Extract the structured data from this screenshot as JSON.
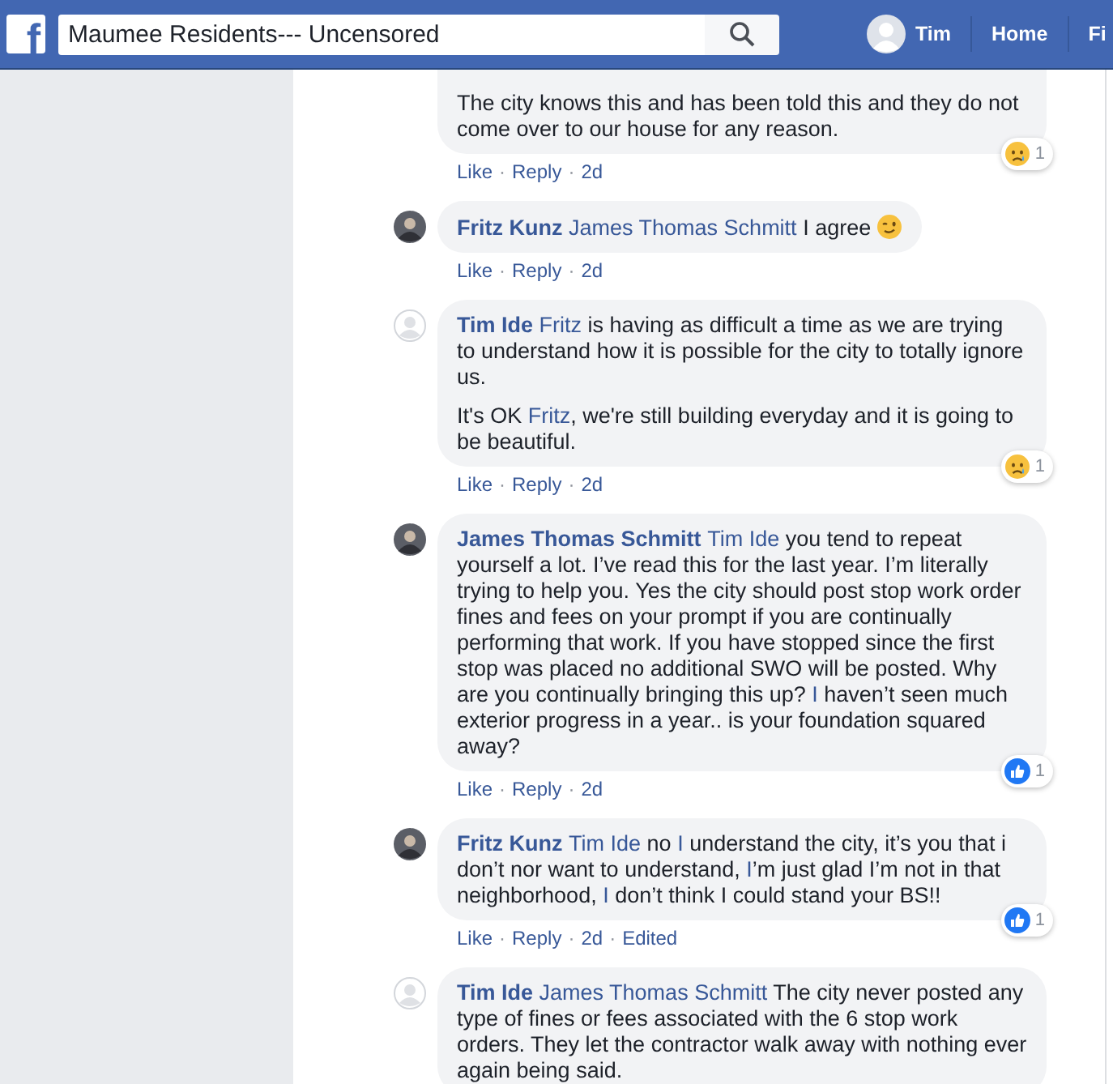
{
  "header": {
    "logo": "f",
    "search": {
      "value": "Maumee Residents--- Uncensored"
    },
    "nav": [
      {
        "label": "Tim",
        "kind": "profile"
      },
      {
        "label": "Home",
        "kind": "link"
      },
      {
        "label": "Fi",
        "kind": "link"
      }
    ]
  },
  "comments": [
    {
      "paragraphs": [
        [
          {
            "text": "The city knows this and has been told this and they do not come over to our house for any reason.",
            "kind": "plain"
          }
        ]
      ],
      "meta": [
        {
          "text": "Like",
          "kind": "link"
        },
        {
          "text": "·",
          "kind": "sep"
        },
        {
          "text": "Reply",
          "kind": "link"
        },
        {
          "text": "·",
          "kind": "sep"
        },
        {
          "text": "2d",
          "kind": "link"
        }
      ],
      "reaction": {
        "kind": "sad",
        "count": "1"
      }
    },
    {
      "avatar": {
        "kind": "photo"
      },
      "author": "Fritz Kunz",
      "paragraphs": [
        [
          {
            "text": "James Thomas Schmitt",
            "kind": "mention"
          },
          {
            "text": " I agree ",
            "kind": "plain"
          },
          {
            "kind": "emoji"
          }
        ]
      ],
      "meta": [
        {
          "text": "Like",
          "kind": "link"
        },
        {
          "text": "·",
          "kind": "sep"
        },
        {
          "text": "Reply",
          "kind": "link"
        },
        {
          "text": "·",
          "kind": "sep"
        },
        {
          "text": "2d",
          "kind": "link"
        }
      ]
    },
    {
      "avatar": {
        "kind": "default"
      },
      "author": "Tim Ide",
      "paragraphs": [
        [
          {
            "text": "Fritz",
            "kind": "mention"
          },
          {
            "text": " is having as difficult a time as we are trying to understand how it is possible for the city to totally ignore us.",
            "kind": "plain"
          }
        ],
        [
          {
            "text": "It's OK ",
            "kind": "plain"
          },
          {
            "text": "Fritz",
            "kind": "mention"
          },
          {
            "text": ", we're still building everyday and it is going to be beautiful.",
            "kind": "plain"
          }
        ]
      ],
      "meta": [
        {
          "text": "Like",
          "kind": "link"
        },
        {
          "text": "·",
          "kind": "sep"
        },
        {
          "text": "Reply",
          "kind": "link"
        },
        {
          "text": "·",
          "kind": "sep"
        },
        {
          "text": "2d",
          "kind": "link"
        }
      ],
      "reaction": {
        "kind": "sad",
        "count": "1"
      }
    },
    {
      "avatar": {
        "kind": "photo"
      },
      "author": "James Thomas Schmitt",
      "paragraphs": [
        [
          {
            "text": "Tim Ide",
            "kind": "mention"
          },
          {
            "text": " you tend to repeat yourself a lot. I’ve read this for the last year. I’m literally trying to help you. Yes the city should post stop work order fines and fees on your prompt if you are continually performing that work. If you have stopped since the first stop was placed no additional SWO will be posted. Why are you continually bringing this up? ",
            "kind": "plain"
          },
          {
            "text": "I",
            "kind": "mention"
          },
          {
            "text": " haven’t seen much exterior progress in a year.. is your foundation squared away?",
            "kind": "plain"
          }
        ]
      ],
      "meta": [
        {
          "text": "Like",
          "kind": "link"
        },
        {
          "text": "·",
          "kind": "sep"
        },
        {
          "text": "Reply",
          "kind": "link"
        },
        {
          "text": "·",
          "kind": "sep"
        },
        {
          "text": "2d",
          "kind": "link"
        }
      ],
      "reaction": {
        "kind": "like",
        "count": "1"
      }
    },
    {
      "avatar": {
        "kind": "photo"
      },
      "author": "Fritz Kunz",
      "paragraphs": [
        [
          {
            "text": "Tim Ide",
            "kind": "mention"
          },
          {
            "text": " no ",
            "kind": "plain"
          },
          {
            "text": "I",
            "kind": "mention"
          },
          {
            "text": " understand the city, it’s you that i don’t nor want to understand, ",
            "kind": "plain"
          },
          {
            "text": "I",
            "kind": "mention"
          },
          {
            "text": "’m just glad I’m not in that neighborhood, ",
            "kind": "plain"
          },
          {
            "text": "I",
            "kind": "mention"
          },
          {
            "text": " don’t think I could stand your BS!!",
            "kind": "plain"
          }
        ]
      ],
      "meta": [
        {
          "text": "Like",
          "kind": "link"
        },
        {
          "text": "·",
          "kind": "sep"
        },
        {
          "text": "Reply",
          "kind": "link"
        },
        {
          "text": "·",
          "kind": "sep"
        },
        {
          "text": "2d",
          "kind": "link"
        },
        {
          "text": "·",
          "kind": "sep"
        },
        {
          "text": "Edited",
          "kind": "link"
        }
      ],
      "reaction": {
        "kind": "like",
        "count": "1"
      }
    },
    {
      "avatar": {
        "kind": "default"
      },
      "author": "Tim Ide",
      "paragraphs": [
        [
          {
            "text": "James Thomas Schmitt",
            "kind": "mention"
          },
          {
            "text": " The city never posted any type of fines or fees associated with the 6 stop work orders. They let the contractor walk away with nothing ever again being said.",
            "kind": "plain"
          }
        ]
      ]
    }
  ]
}
